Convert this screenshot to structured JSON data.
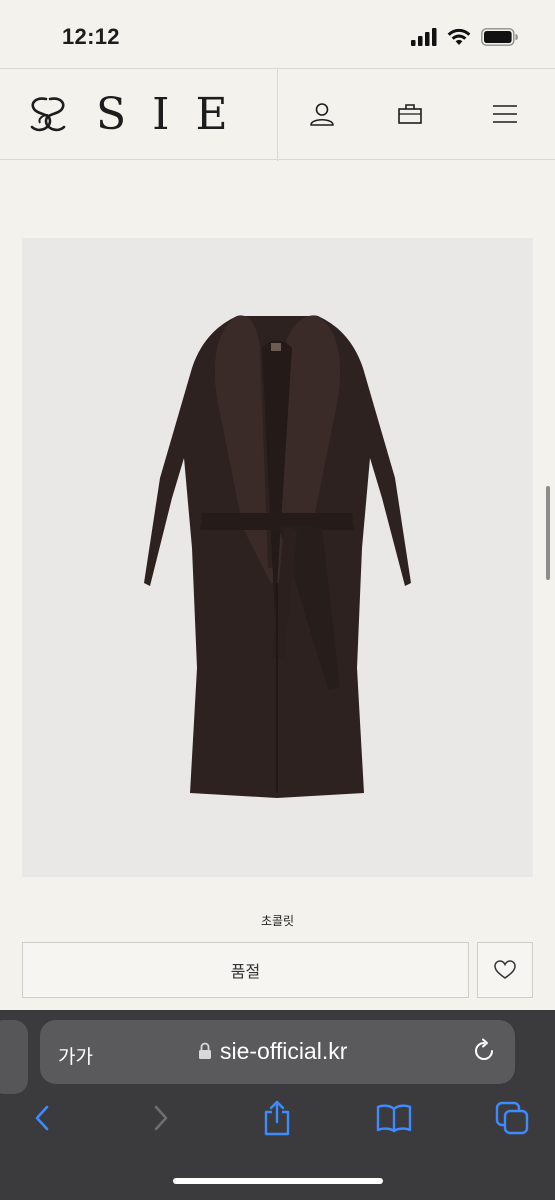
{
  "status_bar": {
    "time": "12:12"
  },
  "site": {
    "brand": "SIE",
    "icons": {
      "account": "user-icon",
      "cart": "shopping-bag-icon",
      "menu": "hamburger-menu-icon"
    }
  },
  "product": {
    "color_name": "초콜릿",
    "sold_out_label": "품절",
    "wishlist_icon": "heart-icon"
  },
  "browser": {
    "text_size_label": "가가",
    "url": "sie-official.kr",
    "toolbar_icons": [
      "back-icon",
      "forward-icon",
      "share-icon",
      "bookmarks-icon",
      "tabs-icon"
    ]
  },
  "colors": {
    "background": "#f3f2ed",
    "coat": "#2e2220",
    "safari_bar": "#3b3b3d",
    "safari_accent": "#3d8bff"
  }
}
